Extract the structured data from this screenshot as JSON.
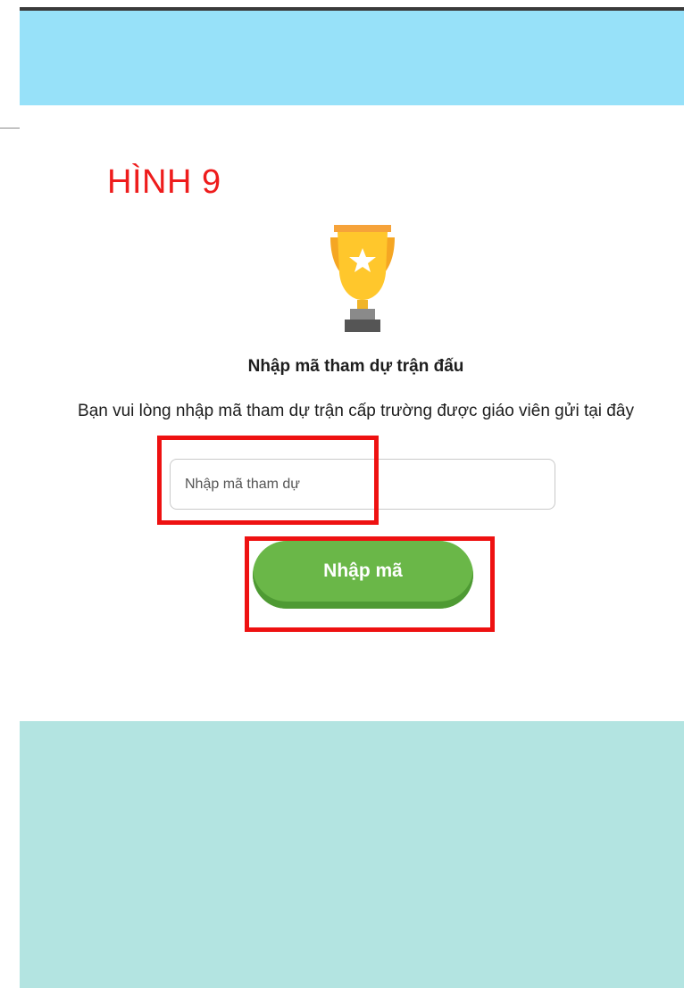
{
  "caption": "HÌNH 9",
  "icons": {
    "trophy": "trophy-icon"
  },
  "colors": {
    "banner": "#97e1f9",
    "button": "#6ab748",
    "highlight": "#ee1111",
    "bottom_panel": "#b3e4e1"
  },
  "form": {
    "title": "Nhập mã tham dự trận đấu",
    "subtitle": "Bạn vui lòng nhập mã tham dự trận cấp trường được giáo viên gửi tại đây",
    "input_placeholder": "Nhập mã tham dự",
    "input_value": "",
    "submit_label": "Nhập mã"
  }
}
